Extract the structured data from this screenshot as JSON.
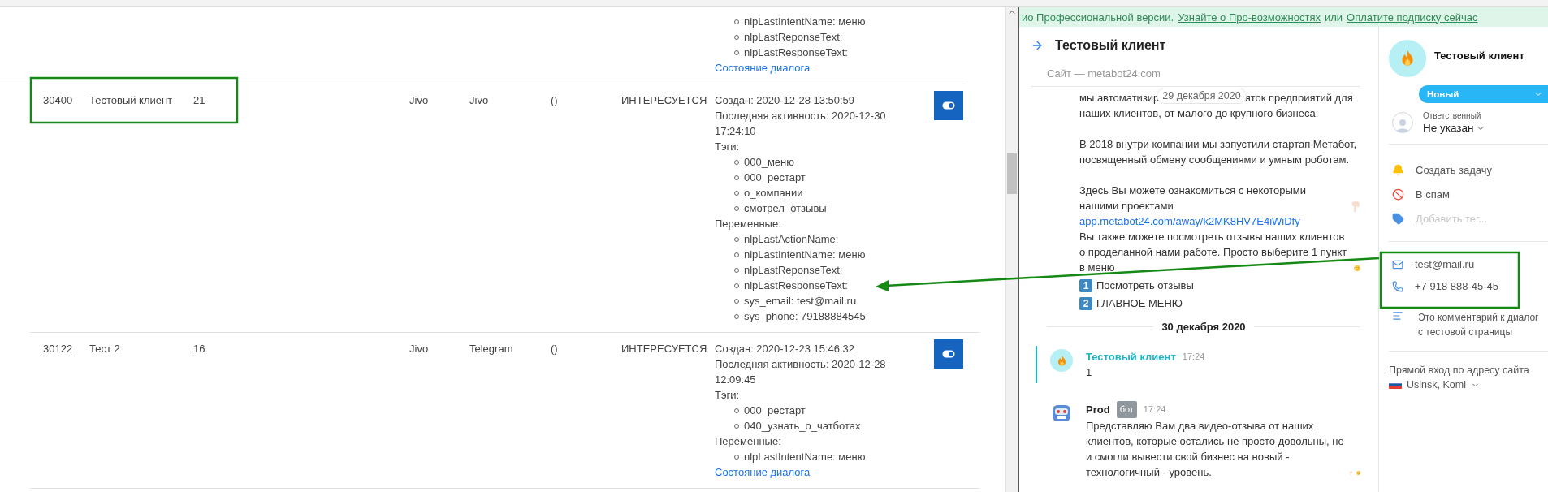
{
  "top_fragment": {
    "variables": [
      "nlpLastIntentName: меню",
      "nlpLastReponseText:",
      "nlpLastResponseText:"
    ],
    "link": "Состояние диалога"
  },
  "rows": [
    {
      "id": "30400",
      "name": "Тестовый клиент",
      "count": "21",
      "source": "Jivo",
      "channel": "Jivo",
      "parens": "()",
      "status": "ИНТЕРЕСУЕТСЯ",
      "created": "Создан: 2020-12-28 13:50:59",
      "activity": "Последняя активность: 2020-12-30 17:24:10",
      "tags_label": "Тэги:",
      "tags": [
        "000_меню",
        "000_рестарт",
        "о_компании",
        "смотрел_отзывы"
      ],
      "vars_label": "Переменные:",
      "variables": [
        "nlpLastActionName:",
        "nlpLastIntentName: меню",
        "nlpLastReponseText:",
        "nlpLastResponseText:",
        "sys_email: test@mail.ru",
        "sys_phone: 79188884545"
      ],
      "toggle_on": true
    },
    {
      "id": "30122",
      "name": "Тест 2",
      "count": "16",
      "source": "Jivo",
      "channel": "Telegram",
      "parens": "()",
      "status": "ИНТЕРЕСУЕТСЯ",
      "created": "Создан: 2020-12-23 15:46:32",
      "activity": "Последняя активность: 2020-12-28 12:09:45",
      "tags_label": "Тэги:",
      "tags": [
        "000_рестарт",
        "040_узнать_о_чатботах"
      ],
      "vars_label": "Переменные:",
      "variables": [
        "nlpLastIntentName: меню"
      ],
      "link": "Состояние диалога",
      "toggle_on": true
    }
  ],
  "banner": {
    "text": "ио Профессиональной версии.",
    "link_1": "Узнайте о Про-возможностях",
    "middle": "или",
    "link_2": "Оплатите подписку сейчас"
  },
  "chat": {
    "title": "Тестовый клиент",
    "site": "Сайт — metabot24.com",
    "blocks": [
      [
        {
          "kind": "covered",
          "before": "мы автоматизир",
          "pill": "29 декабря 2020",
          "after": "яток предприятий для"
        },
        {
          "kind": "text",
          "text": "наших клиентов, от малого до крупного бизнеса."
        }
      ],
      [
        {
          "kind": "text",
          "text": "В 2018 внутри компании мы запустили стартап Метабот, посвященный обмену сообщениями и умным роботам."
        }
      ],
      [
        {
          "kind": "text_pointing",
          "text": "Здесь Вы можете ознакомиться с некоторыми нашими проектами"
        },
        {
          "kind": "link",
          "text": "app.metabot24.com/away/k2MK8HV7E4iWiDfy"
        },
        {
          "kind": "text_winking",
          "text": "Вы также можете посмотреть отзывы наших клиентов о проделанной нами работе. Просто выберите 1 пункт в меню"
        },
        {
          "kind": "option",
          "number": "1",
          "text": "Посмотреть отзывы"
        },
        {
          "kind": "option",
          "number": "2",
          "text": "ГЛАВНОЕ МЕНЮ"
        }
      ]
    ],
    "date_separator": "30 декабря 2020",
    "messages": [
      {
        "kind": "client",
        "author": "Тестовый клиент",
        "time": "17:24",
        "text": "1"
      },
      {
        "kind": "bot",
        "author": "Prod",
        "badge": "бот",
        "time": "17:24",
        "text": "Представляю Вам два видео-отзыва от наших клиентов, которые остались не просто довольны, но и смогли вывести свой бизнес на новый - технологичный - уровень."
      }
    ]
  },
  "sidebar": {
    "name": "Тестовый клиент",
    "status": "Новый",
    "responsible_label": "Ответственный",
    "responsible": "Не указан",
    "actions": [
      {
        "kind": "task",
        "label": "Создать задачу"
      },
      {
        "kind": "spam",
        "label": "В спам"
      },
      {
        "kind": "tag",
        "placeholder": "Добавить тег..."
      }
    ],
    "contacts": [
      {
        "kind": "email",
        "value": "test@mail.ru"
      },
      {
        "kind": "phone",
        "value": "+7 918 888-45-45"
      }
    ],
    "comment": "Это комментарий к диалог\nс тестовой страницы",
    "entry_label": "Прямой вход по адресу сайта",
    "location": "Usinsk, Komi"
  }
}
